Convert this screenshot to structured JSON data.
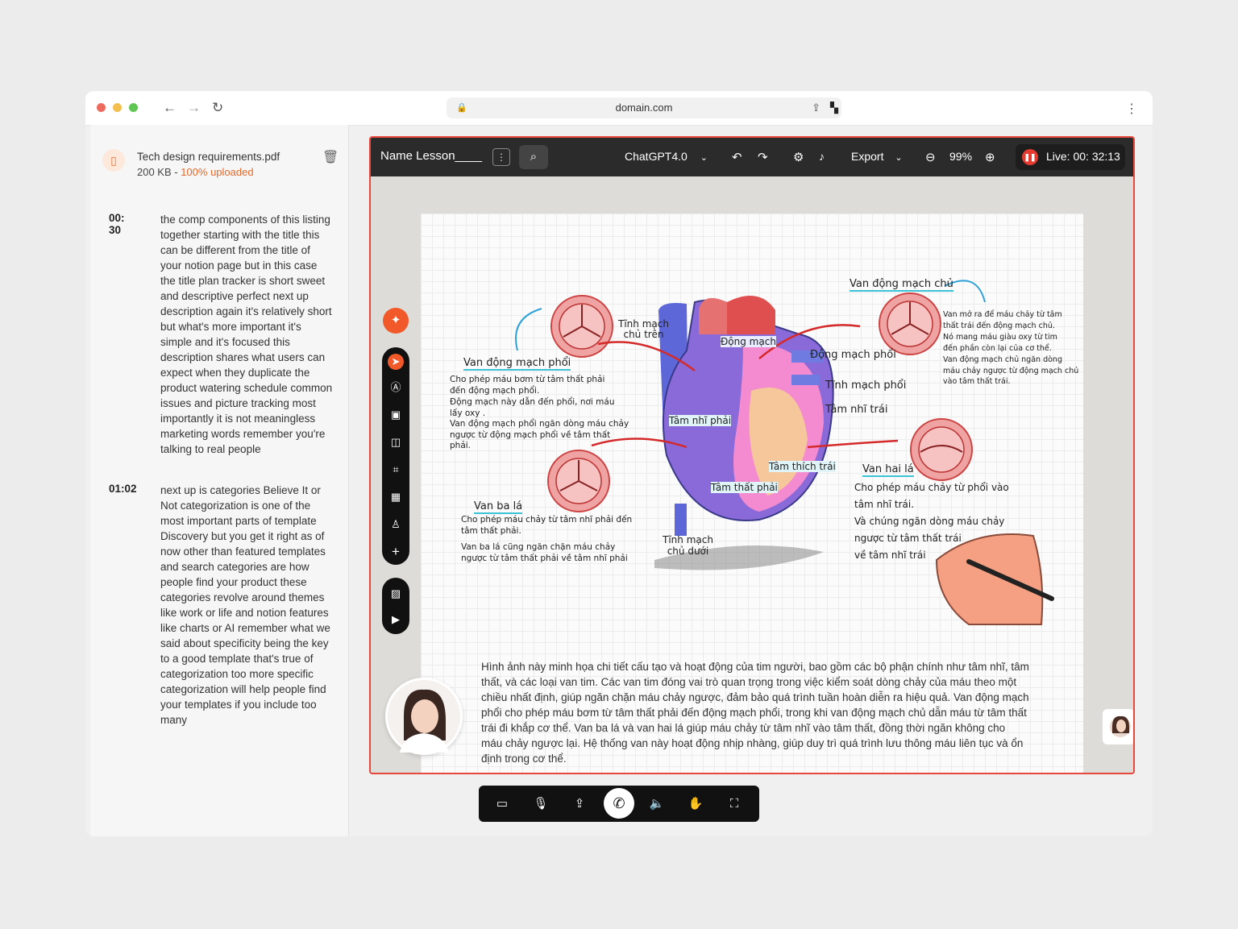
{
  "browser": {
    "url": "domain.com",
    "traffic_lights": [
      "#ed6a5e",
      "#f5bf4f",
      "#61c554"
    ]
  },
  "file": {
    "name": "Tech design requirements.pdf",
    "size": "200 KB - ",
    "status": "100% uploaded"
  },
  "transcript": [
    {
      "time": "00: 30",
      "text": "the comp components of this listing together starting with the title this can be different from the title of your notion page but in this case the title plan tracker is short sweet and descriptive perfect next up description again it's relatively short but what's more important it's simple and it's focused this description shares what users can expect when they duplicate the product watering schedule common issues and picture tracking most importantly it is not meaningless marketing words remember you're talking to real people"
    },
    {
      "time": "01:02",
      "text": "next up is categories Believe It or Not categorization is one of the most important parts of template Discovery but you get it right as of now other than featured templates and search categories are how people find your product these categories revolve around themes like work or life and notion features like charts or AI remember what we said about specificity being the key to a good template that's true of categorization too more specific categorization will help people find your templates if you include too many"
    }
  ],
  "toolbar": {
    "lesson_name": "Name Lesson____",
    "model": "ChatGPT4.0",
    "export": "Export",
    "zoom": "99%",
    "live": "Live: 00: 32:13"
  },
  "diagram": {
    "labels": {
      "tinh_mach_chu_tren": "Tĩnh mạch\nchủ trên",
      "dong_mach": "Động mạch",
      "dong_mach_phoi": "Động mạch phổi",
      "tinh_mach_phoi": "Tĩnh mạch phổi",
      "tam_nhi_trai": "Tâm nhĩ trái",
      "tam_nhi_phai": "Tâm nhĩ phải",
      "tam_that_phai": "Tâm thất phải",
      "tam_thich_trai": "Tâm thích trái",
      "tinh_mach_chu_duoi": "Tĩnh mạch\nchủ dưới"
    },
    "van_dong_mach_phoi": {
      "title": "Van động mạch phổi",
      "lines": [
        "Cho phép máu bơm từ tâm thất phải\nđến động mạch phổi.",
        "Động mạch này dẫn đến phổi, nơi máu\nlấy oxy .",
        "Van động mạch phổi ngăn dòng máu chảy\nngược từ động mạch phổi về tâm thất\nphải."
      ]
    },
    "van_dong_mach_chu": {
      "title": "Van động mạch chủ",
      "lines": [
        "Van mở ra để máu chảy từ tâm\nthất trái đến động mạch chủ.",
        "Nó mang máu giàu oxy từ tim\nđến phần còn lại của cơ thể.",
        "Van động mạch chủ ngăn dòng\nmáu chảy ngược từ động mạch chủ\nvào tâm thất trái."
      ]
    },
    "van_ba_la": {
      "title": "Van ba lá",
      "lines": [
        "Cho phép máu chảy từ tâm nhĩ phải đến\ntâm thất phải.",
        "Van ba lá cũng ngăn chặn máu chảy\nngược từ tâm thất phải về tâm nhĩ phải"
      ]
    },
    "van_hai_la": {
      "title": "Van hai lá",
      "lines": [
        "Cho phép máu chảy từ phổi vào\ntâm nhĩ trái.",
        "Và chúng ngăn dòng máu chảy\nngược từ tâm thất trái\nvề tâm nhĩ trái"
      ]
    }
  },
  "description": "Hình ảnh này minh họa chi tiết cấu tạo và hoạt động của tim người, bao gồm các bộ phận chính như tâm nhĩ, tâm thất, và các loại van tim. Các van tim đóng vai trò quan trọng trong việc kiểm soát dòng chảy của máu theo một chiều nhất định, giúp ngăn chặn máu chảy ngược, đảm bảo quá trình tuần hoàn diễn ra hiệu quả. Van động mạch phổi cho phép máu bơm từ tâm thất phải đến động mạch phổi, trong khi van động mạch chủ dẫn máu từ tâm thất trái đi khắp cơ thể. Van ba lá và van hai lá giúp máu chảy từ tâm nhĩ vào tâm thất, đồng thời ngăn không cho máu chảy ngược lại. Hệ thống van này hoạt động nhịp nhàng, giúp duy trì quá trình lưu thông máu liên tục và ổn định trong cơ thể.",
  "colors": {
    "accent": "#e8483c",
    "orange": "#f1592a",
    "dark": "#2b2b2b"
  }
}
